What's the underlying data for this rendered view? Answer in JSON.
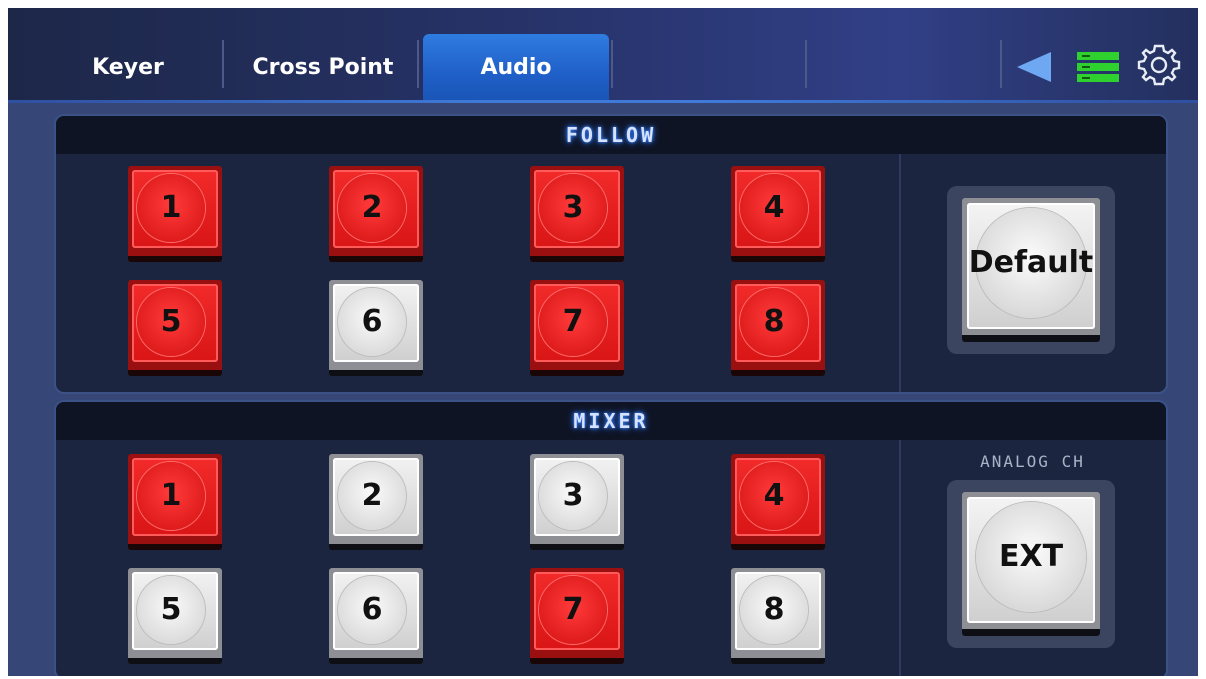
{
  "tabs": [
    {
      "label": "Keyer",
      "active": false
    },
    {
      "label": "Cross Point",
      "active": false
    },
    {
      "label": "Audio",
      "active": true
    }
  ],
  "toolbar": {
    "back_icon": "back-triangle-icon",
    "status_icon": "list-icon",
    "settings_icon": "gear-icon",
    "status_color": "#2fd12f"
  },
  "follow": {
    "title": "FOLLOW",
    "buttons": [
      {
        "label": "1",
        "state": "on"
      },
      {
        "label": "2",
        "state": "on"
      },
      {
        "label": "3",
        "state": "on"
      },
      {
        "label": "4",
        "state": "on"
      },
      {
        "label": "5",
        "state": "on"
      },
      {
        "label": "6",
        "state": "off"
      },
      {
        "label": "7",
        "state": "on"
      },
      {
        "label": "8",
        "state": "on"
      }
    ],
    "default_button": "Default"
  },
  "mixer": {
    "title": "MIXER",
    "buttons": [
      {
        "label": "1",
        "state": "on"
      },
      {
        "label": "2",
        "state": "off"
      },
      {
        "label": "3",
        "state": "off"
      },
      {
        "label": "4",
        "state": "on"
      },
      {
        "label": "5",
        "state": "off"
      },
      {
        "label": "6",
        "state": "off"
      },
      {
        "label": "7",
        "state": "on"
      },
      {
        "label": "8",
        "state": "off"
      }
    ],
    "analog_label": "ANALOG CH",
    "ext_button": "EXT"
  },
  "colors": {
    "on": "#e21c1c",
    "off": "#e6e6e6",
    "active_tab": "#1f5fc8",
    "panel_bg": "#1c2540"
  }
}
